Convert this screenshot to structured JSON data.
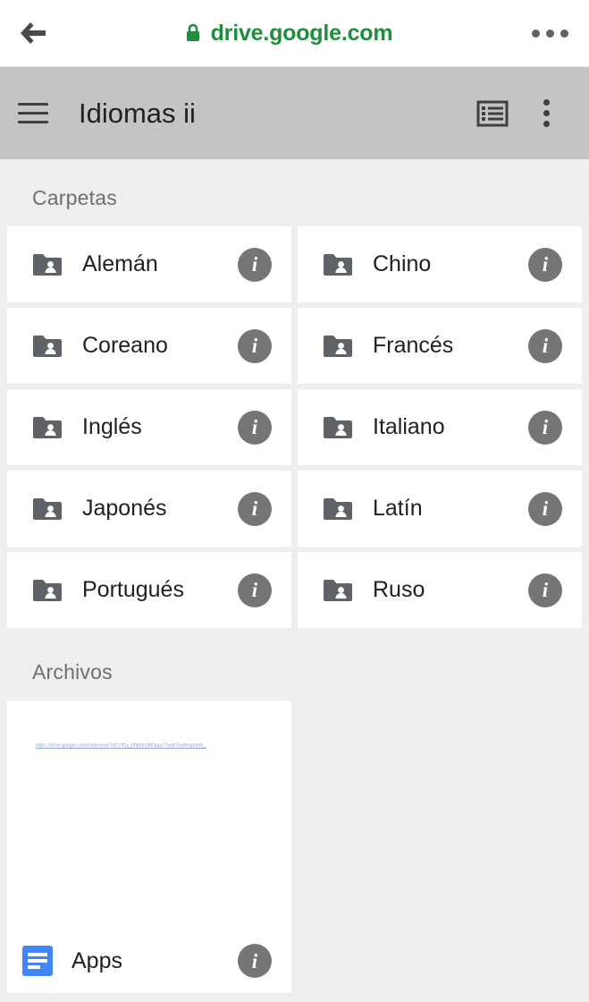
{
  "browser": {
    "back_icon": "back-arrow-icon",
    "lock_icon": "lock-icon",
    "url": "drive.google.com",
    "menu_icon": "more-horizontal-icon",
    "url_color": "#1e8e3e"
  },
  "app_header": {
    "menu_icon": "hamburger-menu-icon",
    "title": "Idiomas ii",
    "view_toggle_icon": "list-view-icon",
    "overflow_icon": "more-vertical-icon",
    "background_color": "#c4c4c4"
  },
  "sections": {
    "folders": {
      "title": "Carpetas",
      "items": [
        {
          "name": "Alemán",
          "icon": "shared-folder-icon",
          "info_label": "i"
        },
        {
          "name": "Chino",
          "icon": "shared-folder-icon",
          "info_label": "i"
        },
        {
          "name": "Coreano",
          "icon": "shared-folder-icon",
          "info_label": "i"
        },
        {
          "name": "Francés",
          "icon": "shared-folder-icon",
          "info_label": "i"
        },
        {
          "name": "Inglés",
          "icon": "shared-folder-icon",
          "info_label": "i"
        },
        {
          "name": "Italiano",
          "icon": "shared-folder-icon",
          "info_label": "i"
        },
        {
          "name": "Japonés",
          "icon": "shared-folder-icon",
          "info_label": "i"
        },
        {
          "name": "Latín",
          "icon": "shared-folder-icon",
          "info_label": "i"
        },
        {
          "name": "Portugués",
          "icon": "shared-folder-icon",
          "info_label": "i"
        },
        {
          "name": "Ruso",
          "icon": "shared-folder-icon",
          "info_label": "i"
        }
      ]
    },
    "files": {
      "title": "Archivos",
      "items": [
        {
          "name": "Apps",
          "icon": "google-docs-icon",
          "info_label": "i",
          "thumbnail_link": "https://drive.google.com/folderview?id=1ff1y_bf9jbXsMDqqa77wdCGeNmpbbeh_"
        }
      ]
    }
  },
  "colors": {
    "page_background": "#eeeeee",
    "card_background": "#ffffff",
    "info_button": "#757575",
    "folder_icon": "#5f6368",
    "docs_icon": "#4285f4"
  }
}
